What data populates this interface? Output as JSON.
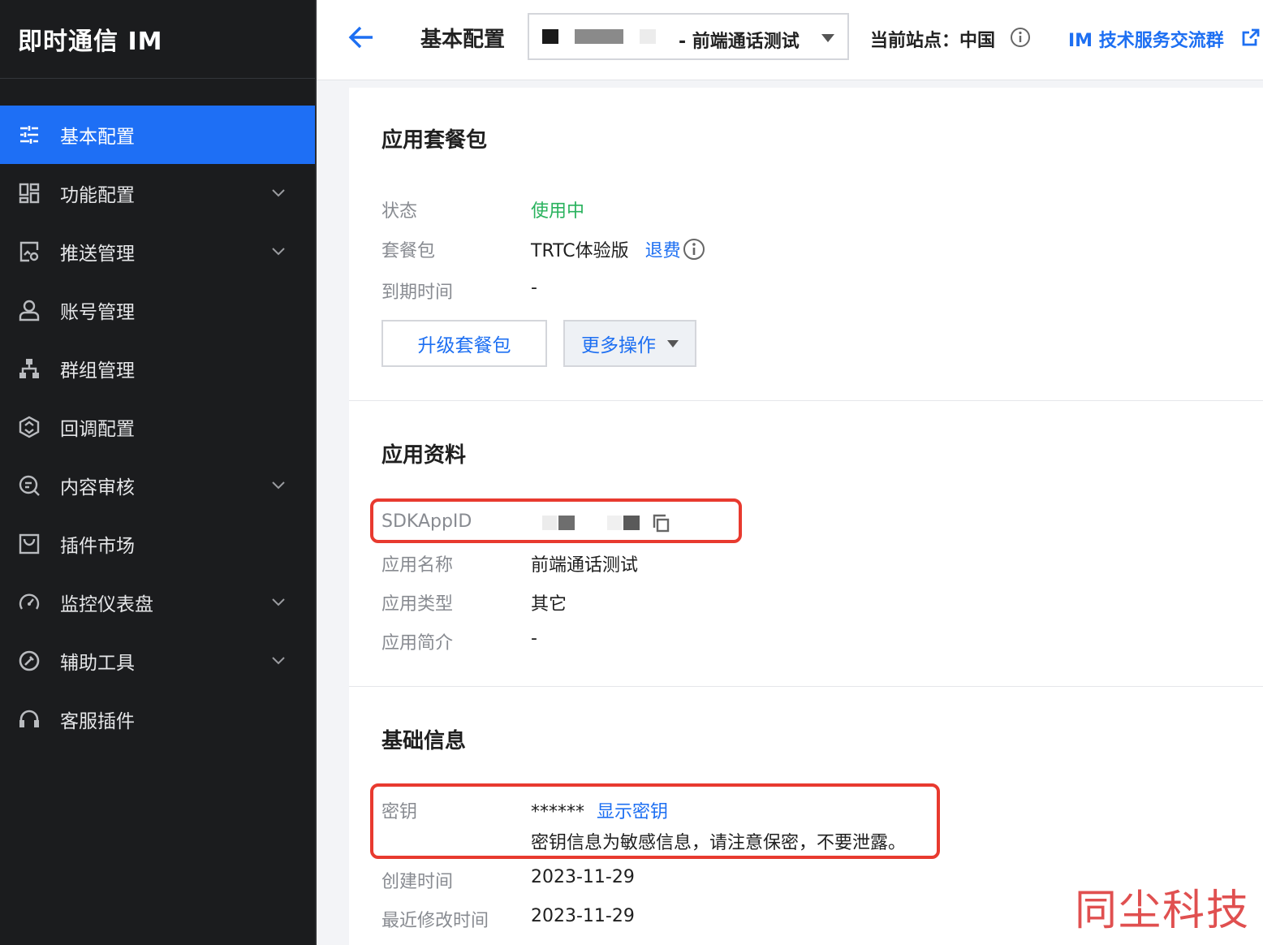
{
  "sidebar": {
    "brand": "即时通信 IM",
    "items": [
      {
        "label": "基本配置",
        "icon": "sliders-icon",
        "active": true,
        "expandable": false
      },
      {
        "label": "功能配置",
        "icon": "dashboard-grid-icon",
        "expandable": true
      },
      {
        "label": "推送管理",
        "icon": "push-icon",
        "expandable": true
      },
      {
        "label": "账号管理",
        "icon": "user-icon",
        "expandable": false
      },
      {
        "label": "群组管理",
        "icon": "org-chart-icon",
        "expandable": false
      },
      {
        "label": "回调配置",
        "icon": "callback-icon",
        "expandable": false
      },
      {
        "label": "内容审核",
        "icon": "content-audit-icon",
        "expandable": true
      },
      {
        "label": "插件市场",
        "icon": "plugin-market-icon",
        "expandable": false
      },
      {
        "label": "监控仪表盘",
        "icon": "gauge-icon",
        "expandable": true
      },
      {
        "label": "辅助工具",
        "icon": "tools-icon",
        "expandable": true
      },
      {
        "label": "客服插件",
        "icon": "headset-icon",
        "expandable": false
      }
    ]
  },
  "topbar": {
    "title": "基本配置",
    "app_select": {
      "value": "- 前端通话测试"
    },
    "site_label": "当前站点：中国",
    "community_link": "IM 技术服务交流群"
  },
  "package": {
    "title": "应用套餐包",
    "status_label": "状态",
    "status_value": "使用中",
    "status_color": "#29b25d",
    "plan_label": "套餐包",
    "plan_value": "TRTC体验版",
    "refund_link": "退费",
    "expire_label": "到期时间",
    "expire_value": "-",
    "upgrade_button": "升级套餐包",
    "more_button": "更多操作"
  },
  "app_info": {
    "title": "应用资料",
    "sdkappid_label": "SDKAppID",
    "name_label": "应用名称",
    "name_value": "前端通话测试",
    "type_label": "应用类型",
    "type_value": "其它",
    "intro_label": "应用简介",
    "intro_value": "-"
  },
  "basic_info": {
    "title": "基础信息",
    "key_label": "密钥",
    "key_mask": "******",
    "show_key_link": "显示密钥",
    "key_hint": "密钥信息为敏感信息，请注意保密，不要泄露。",
    "created_label": "创建时间",
    "created_value": "2023-11-29",
    "modified_label": "最近修改时间",
    "modified_value": "2023-11-29"
  },
  "watermark": "同尘科技",
  "colors": {
    "accent": "#1e6ff5",
    "highlight": "#e83a2f",
    "sidebar_bg": "#1b1c1e"
  }
}
